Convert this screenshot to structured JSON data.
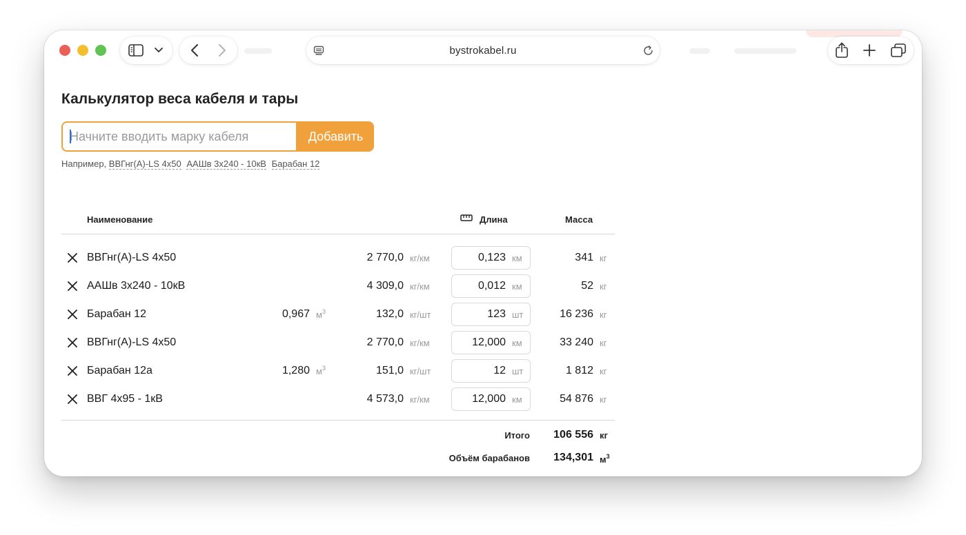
{
  "browser": {
    "url": "bystrokabel.ru",
    "icons": [
      "sidebar-icon",
      "chevron-down-icon",
      "back-icon",
      "forward-icon",
      "page-menu-icon",
      "reload-icon",
      "share-icon",
      "new-tab-icon",
      "tabs-overview-icon"
    ]
  },
  "page": {
    "title": "Калькулятор веса кабеля и тары",
    "search": {
      "placeholder": "Начните вводить марку кабеля",
      "value": "",
      "button_label": "Добавить"
    },
    "examples": {
      "prefix": "Например,",
      "links": [
        "ВВГнг(А)-LS 4x50",
        "ААШв 3х240 - 10кВ",
        "Барабан 12"
      ]
    }
  },
  "table": {
    "headers": {
      "name": "Наименование",
      "length": "Длина",
      "mass": "Масса"
    },
    "rows": [
      {
        "name": "ВВГнг(А)-LS 4x50",
        "volume": "",
        "volume_unit": "",
        "weight": "2 770,0",
        "weight_unit": "кг/км",
        "length": "0,123",
        "length_unit": "км",
        "mass": "341",
        "mass_unit": "кг"
      },
      {
        "name": "ААШв 3х240 - 10кВ",
        "volume": "",
        "volume_unit": "",
        "weight": "4 309,0",
        "weight_unit": "кг/км",
        "length": "0,012",
        "length_unit": "км",
        "mass": "52",
        "mass_unit": "кг"
      },
      {
        "name": "Барабан 12",
        "volume": "0,967",
        "volume_unit": "м",
        "weight": "132,0",
        "weight_unit": "кг/шт",
        "length": "123",
        "length_unit": "шт",
        "mass": "16 236",
        "mass_unit": "кг"
      },
      {
        "name": "ВВГнг(А)-LS 4x50",
        "volume": "",
        "volume_unit": "",
        "weight": "2 770,0",
        "weight_unit": "кг/км",
        "length": "12,000",
        "length_unit": "км",
        "mass": "33 240",
        "mass_unit": "кг"
      },
      {
        "name": "Барабан 12а",
        "volume": "1,280",
        "volume_unit": "м",
        "weight": "151,0",
        "weight_unit": "кг/шт",
        "length": "12",
        "length_unit": "шт",
        "mass": "1 812",
        "mass_unit": "кг"
      },
      {
        "name": "ВВГ 4х95 - 1кВ",
        "volume": "",
        "volume_unit": "",
        "weight": "4 573,0",
        "weight_unit": "кг/км",
        "length": "12,000",
        "length_unit": "км",
        "mass": "54 876",
        "mass_unit": "кг"
      }
    ],
    "volume_superscript": "3",
    "totals": {
      "total_label": "Итого",
      "total_value": "106 556",
      "total_unit": "кг",
      "volume_label": "Объём барабанов",
      "volume_value": "134,301",
      "volume_unit": "м",
      "volume_superscript": "3"
    }
  },
  "colors": {
    "accent": "#f1a13c",
    "accent_border": "#f0a23a",
    "traffic_red": "#ec5f57",
    "traffic_yellow": "#f3bf2f",
    "traffic_green": "#5fc454"
  }
}
